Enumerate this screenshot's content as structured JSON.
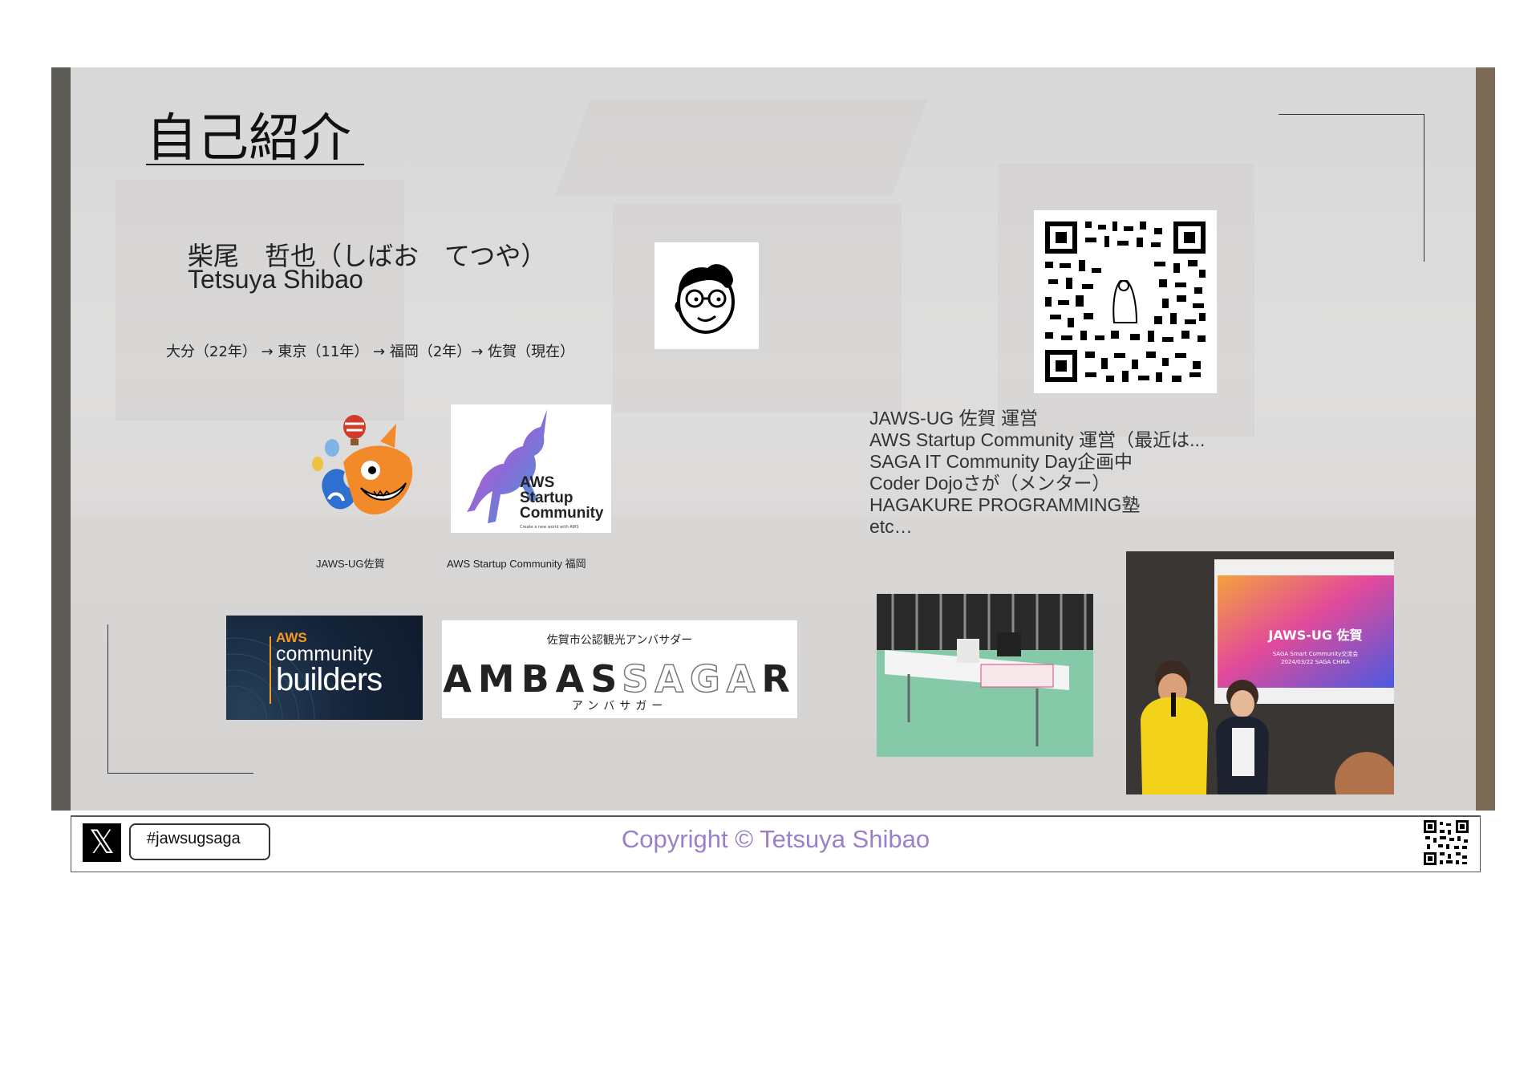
{
  "slide": {
    "title": "自己紹介",
    "profile": {
      "name_jp": "柴尾　哲也（しばお　てつや）",
      "name_en": "Tetsuya Shibao",
      "history": "大分（22年） → 東京（11年） → 福岡（2年）→ 佐賀（現在）"
    },
    "roles": [
      "JAWS-UG 佐賀 運営",
      "AWS Startup Community 運営（最近は...",
      "SAGA IT Community Day企画中",
      "Coder Dojoさが（メンター）",
      "HAGAKURE PROGRAMMING塾",
      "etc…"
    ],
    "logos": {
      "jaws_caption": "JAWS-UG佐賀",
      "asc_caption": "AWS Startup Community 福岡",
      "asc_text": [
        "AWS",
        "Startup",
        "Community"
      ],
      "asc_tagline": "Create a new world with AWS",
      "builders_aws": "AWS",
      "builders_line1": "community",
      "builders_line2": "builders",
      "ambassagar_top": "佐賀市公認観光アンバサダー",
      "ambassagar_main_a": "AMBAS",
      "ambassagar_main_b": "SAGA",
      "ambassagar_main_c": "R",
      "ambassagar_bottom": "アンバサガー"
    },
    "photos": {
      "stage_banner": "JAWS-UG 佐賀",
      "stage_sub1": "SAGA Smart Community交流会",
      "stage_sub2": "2024/03/22 SAGA CHIKA"
    }
  },
  "footer": {
    "x_icon": "x-logo-icon",
    "hashtag": "#jawsugsaga",
    "copyright": "Copyright © Tetsuya Shibao"
  },
  "colors": {
    "copyright": "#9a80c9",
    "builders_orange": "#f79a1e",
    "builders_navy": "#15243a"
  }
}
